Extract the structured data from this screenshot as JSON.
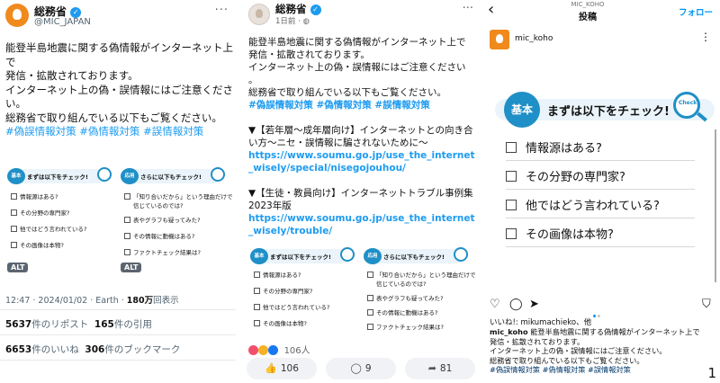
{
  "x_post": {
    "name": "総務省",
    "handle": "@MIC_JAPAN",
    "body_lines": [
      "能登半島地震に関する偽情報がインターネット上で",
      "発信・拡散されております。",
      "インターネット上の偽・誤情報にはご注意くださ",
      "い。",
      "総務省で取り組んでいる以下もご覧ください。"
    ],
    "hashtags": "#偽誤情報対策 #偽情報対策 #誤情報対策",
    "alt_label": "ALT",
    "meta_time": "12:47 · 2024/01/02 · Earth · ",
    "meta_views_num": "180万",
    "meta_views_label": "回表示",
    "reposts_num": "5637",
    "reposts_label": "件のリポスト",
    "quotes_num": "165",
    "quotes_label": "件の引用",
    "likes_num": "6653",
    "likes_label": "件のいいね",
    "bookmarks_num": "306",
    "bookmarks_label": "件のブックマーク"
  },
  "checklist_basic": {
    "badge": "基本",
    "title": "まずは以下をチェック!",
    "items": [
      "情報源はある?",
      "その分野の専門家?",
      "他ではどう言われている?",
      "その画像は本物?"
    ]
  },
  "checklist_applied": {
    "badge": "応用",
    "title": "さらに以下もチェック!",
    "items": [
      "「知り合いだから」という理由だけで",
      "信じているのでは?",
      "表やグラフも疑ってみた?",
      "その情報に動機はある?",
      "ファクトチェック結果は?"
    ]
  },
  "fb_post": {
    "name": "総務省",
    "sub": "1日前 · ",
    "body_lines": [
      "能登半島地震に関する偽情報がインターネット上で",
      "発信・拡散されております。",
      "インターネット上の偽・誤情報にはご注意ください",
      "。",
      "総務省で取り組んでいる以下もご覧ください。"
    ],
    "hashtags": "#偽誤情報対策 #偽情報対策 #誤情報対策",
    "item1_title": "▼【若年層〜成年層向け】インターネットとの向き合い方〜ニセ・誤情報に騙されないために〜",
    "item1_url": "https://www.soumu.go.jp/use_the_internet_wisely/special/nisegojouhou/",
    "item2_title": "▼【生徒・教員向け】インターネットトラブル事例集2023年版",
    "item2_url": "https://www.soumu.go.jp/use_the_internet_wisely/trouble/",
    "reactions": "106人",
    "like_count": "106",
    "comment_count": "9",
    "share_count": "81"
  },
  "ig_post": {
    "header_sub": "MIC_KOHO",
    "header_title": "投稿",
    "follow": "フォロー",
    "username": "mic_koho",
    "likes_text": "いいね!: mikumachieko、他",
    "caption_user": "mic_koho",
    "caption_lines": [
      " 能登半島地震に関する偽情報がインターネット上で",
      "発信・拡散されております。",
      "インターネット上の偽・誤情報にはご注意ください。",
      "総務省で取り組んでいる以下もご覧ください。"
    ],
    "hashtags": "#偽誤情報対策 #偽情報対策 #誤情報対策",
    "figure_number": "1"
  },
  "icons": {
    "more": "more-options-icon",
    "verified": "verified-badge-icon",
    "back": "back-arrow-icon",
    "heart": "heart-icon",
    "comment": "comment-icon",
    "share": "share-icon",
    "bookmark": "bookmark-icon",
    "like": "thumbs-up-icon"
  },
  "colors": {
    "x_link": "#1d9bf0",
    "ig_follow": "#0095f6",
    "checklist_blue": "#1f8fc7",
    "highlight": "#fbe57a",
    "brand_orange": "#f08a1c"
  }
}
